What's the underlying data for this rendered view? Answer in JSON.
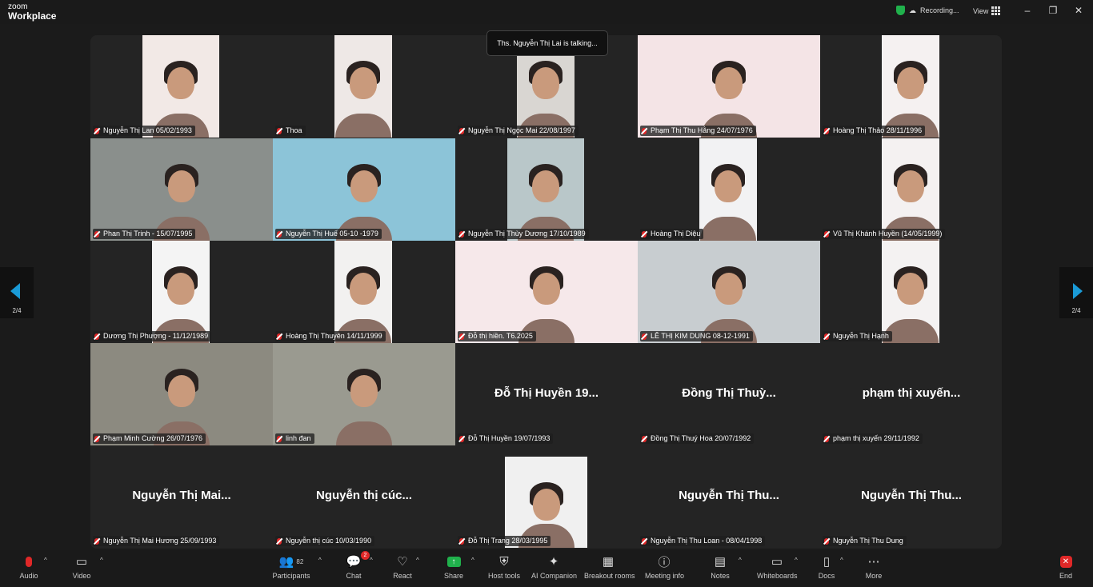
{
  "app": {
    "brand_line1": "zoom",
    "brand_line2": "Workplace"
  },
  "titlebar": {
    "recording": "Recording...",
    "view": "View"
  },
  "talking_banner": "Ths. Nguyễn Thị Lai is talking...",
  "pagination": {
    "left": "2/4",
    "right": "2/4"
  },
  "participants": [
    {
      "name": "Nguyễn Thị Lan 05/02/1993",
      "big": ""
    },
    {
      "name": "Thoa",
      "big": ""
    },
    {
      "name": "Nguyễn Thị Ngọc Mai 22/08/1997",
      "big": ""
    },
    {
      "name": "Phạm Thị Thu Hằng 24/07/1976",
      "big": ""
    },
    {
      "name": "Hoàng Thị Thảo 28/11/1996",
      "big": ""
    },
    {
      "name": "Phan Thị Trinh - 15/07/1995",
      "big": ""
    },
    {
      "name": "Nguyễn Thị Huế 05-10 -1979",
      "big": ""
    },
    {
      "name": "Nguyễn Thị Thùy Dương 17/10/1989",
      "big": ""
    },
    {
      "name": "Hoàng Thị Diệu",
      "big": ""
    },
    {
      "name": "Vũ Thị Khánh Huyền (14/05/1999)",
      "big": ""
    },
    {
      "name": "Dương Thị Phượng - 11/12/1989",
      "big": ""
    },
    {
      "name": "Hoàng Thị Thuyên 14/11/1999",
      "big": ""
    },
    {
      "name": "Đỗ thị hiền. T6.2025",
      "big": ""
    },
    {
      "name": "LÊ THỊ KIM DUNG 08-12-1991",
      "big": ""
    },
    {
      "name": "Nguyễn Thị Hạnh",
      "big": ""
    },
    {
      "name": "Phạm Minh Cường 26/07/1976",
      "big": ""
    },
    {
      "name": "linh đan",
      "big": ""
    },
    {
      "name": "Đỗ Thị Huyền 19/07/1993",
      "big": "Đỗ Thị Huyền 19..."
    },
    {
      "name": "Đồng Thị Thuý Hoa 20/07/1992",
      "big": "Đồng Thị Thuỳ..."
    },
    {
      "name": "phạm thị xuyến 29/11/1992",
      "big": "phạm thị xuyến..."
    },
    {
      "name": "Nguyễn Thị Mai Hương 25/09/1993",
      "big": "Nguyễn Thị Mai..."
    },
    {
      "name": "Nguyễn thị cúc 10/03/1990",
      "big": "Nguyễn thị cúc..."
    },
    {
      "name": "Đỗ Thị Trang 28/03/1995",
      "big": ""
    },
    {
      "name": "Nguyễn Thị Thu Loan - 08/04/1998",
      "big": "Nguyễn Thị Thu..."
    },
    {
      "name": "Nguyễn Thị Thu Dung",
      "big": "Nguyễn Thị Thu..."
    }
  ],
  "toolbar": {
    "audio": "Audio",
    "video": "Video",
    "participants": "Participants",
    "participants_count": "82",
    "chat": "Chat",
    "chat_badge": "2",
    "react": "React",
    "share": "Share",
    "host_tools": "Host tools",
    "ai_companion": "AI Companion",
    "breakout_rooms": "Breakout rooms",
    "meeting_info": "Meeting info",
    "notes": "Notes",
    "whiteboards": "Whiteboards",
    "docs": "Docs",
    "more": "More",
    "end": "End"
  },
  "colors": {
    "end_red": "#e02828",
    "share_green": "#20b14c",
    "nav_blue": "#1a9ad6"
  }
}
